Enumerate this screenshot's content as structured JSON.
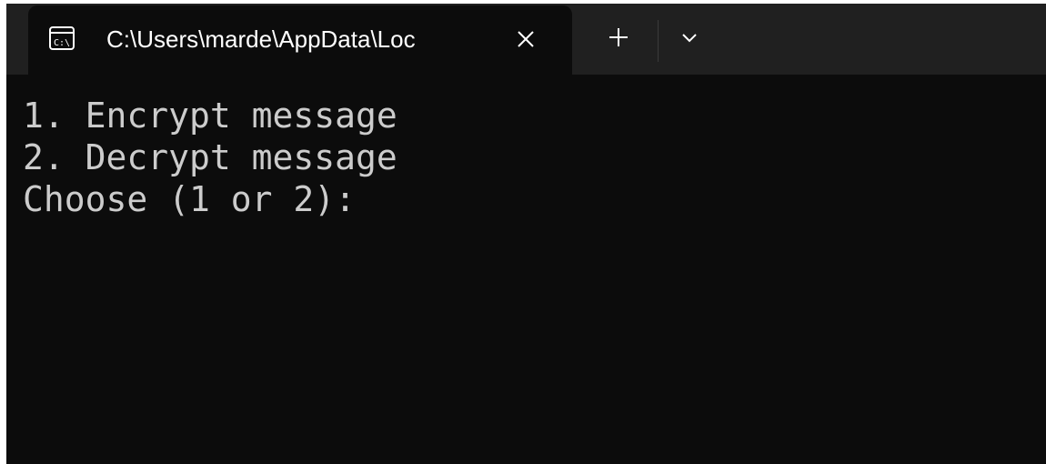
{
  "window": {
    "tab": {
      "title": "C:\\Users\\marde\\AppData\\Loc",
      "icon": "command-prompt-icon"
    },
    "controls": {
      "close_icon": "close-icon",
      "new_tab_icon": "plus-icon",
      "dropdown_icon": "chevron-down-icon"
    }
  },
  "console": {
    "lines": [
      "1. Encrypt message",
      "2. Decrypt message",
      "Choose (1 or 2): "
    ]
  },
  "colors": {
    "terminal_background": "#0c0c0c",
    "titlebar_background": "#202020",
    "terminal_text": "#cccccc",
    "tab_text": "#ffffff"
  }
}
